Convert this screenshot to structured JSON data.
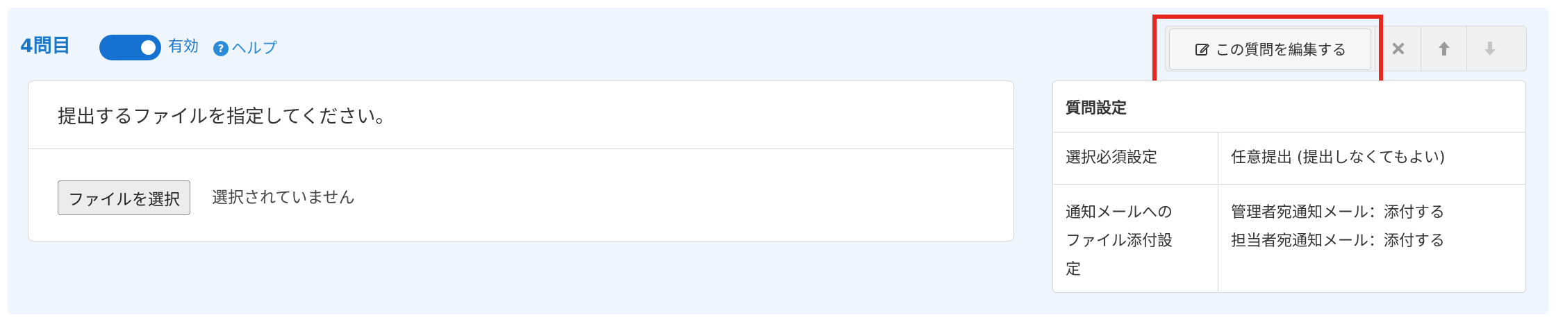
{
  "question": {
    "number": "4問目",
    "enabled": true,
    "enabled_label": "有効",
    "help_label": "ヘルプ"
  },
  "toolbar": {
    "edit_label": "この質問を編集する"
  },
  "file_question": {
    "prompt": "提出するファイルを指定してください。",
    "select_button_label": "ファイルを選択",
    "no_file_text": "選択されていません"
  },
  "settings": {
    "title": "質問設定",
    "rows": [
      {
        "label": "選択必須設定",
        "value": "任意提出 (提出しなくてもよい)"
      },
      {
        "label_lines": [
          "通知メールへの",
          "ファイル添付設",
          "定"
        ],
        "value_lines": [
          "管理者宛通知メール：添付する",
          "担当者宛通知メール：添付する"
        ]
      }
    ]
  },
  "colors": {
    "panel_bg": "#eef5fd",
    "accent": "#1976c8",
    "toggle_on": "#1672d1",
    "highlight": "#e8281f"
  },
  "icons": [
    "edit-icon",
    "delete-icon",
    "move-up-icon",
    "move-down-icon",
    "help-icon"
  ]
}
